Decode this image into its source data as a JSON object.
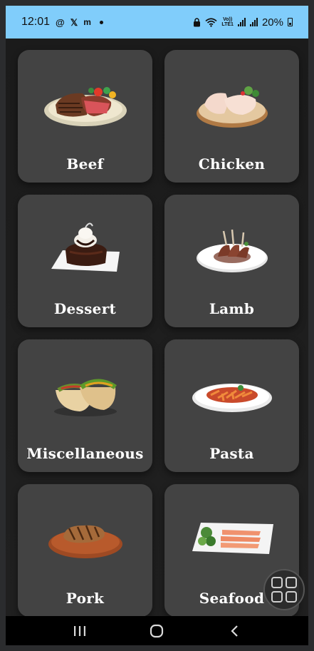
{
  "status_bar": {
    "time": "12:01",
    "volte": "Vo))\nLTE1",
    "battery_text": "20%"
  },
  "categories": [
    {
      "label": "Beef",
      "icon": "beef-steak-image"
    },
    {
      "label": "Chicken",
      "icon": "chicken-image"
    },
    {
      "label": "Dessert",
      "icon": "dessert-cake-image"
    },
    {
      "label": "Lamb",
      "icon": "lamb-chops-image"
    },
    {
      "label": "Miscellaneous",
      "icon": "tacos-image"
    },
    {
      "label": "Pasta",
      "icon": "pasta-image"
    },
    {
      "label": "Pork",
      "icon": "pork-chop-image"
    },
    {
      "label": "Seafood",
      "icon": "salmon-plate-image"
    }
  ],
  "nav": {
    "recents": "recents-icon",
    "home": "home-icon",
    "back": "back-icon"
  },
  "fab": {
    "icon": "grid-apps-icon"
  },
  "colors": {
    "status_bar": "#80cdfb",
    "card": "#434343",
    "background": "#1b1b1b",
    "label": "#ffffff"
  }
}
